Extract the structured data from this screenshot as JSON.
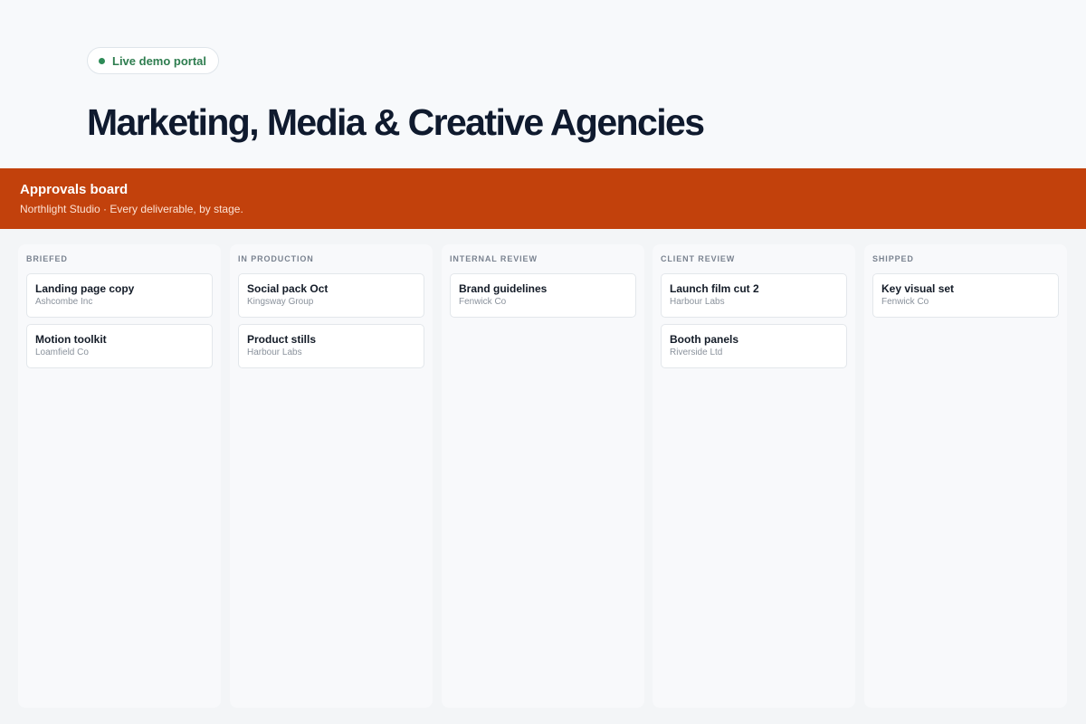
{
  "hero": {
    "badge_label": "Live demo portal",
    "title": "Marketing, Media & Creative Agencies"
  },
  "banner": {
    "title": "Approvals board",
    "subtitle": "Northlight Studio · Every deliverable, by stage."
  },
  "columns": [
    {
      "heading": "Briefed",
      "cards": [
        {
          "title": "Landing page copy",
          "client": "Ashcombe Inc"
        },
        {
          "title": "Motion toolkit",
          "client": "Loamfield Co"
        }
      ]
    },
    {
      "heading": "In Production",
      "cards": [
        {
          "title": "Social pack Oct",
          "client": "Kingsway Group"
        },
        {
          "title": "Product stills",
          "client": "Harbour Labs"
        }
      ]
    },
    {
      "heading": "Internal Review",
      "cards": [
        {
          "title": "Brand guidelines",
          "client": "Fenwick Co"
        }
      ]
    },
    {
      "heading": "Client Review",
      "cards": [
        {
          "title": "Launch film cut 2",
          "client": "Harbour Labs"
        },
        {
          "title": "Booth panels",
          "client": "Riverside Ltd"
        }
      ]
    },
    {
      "heading": "Shipped",
      "cards": [
        {
          "title": "Key visual set",
          "client": "Fenwick Co"
        }
      ]
    }
  ],
  "colors": {
    "banner": "#c2410c",
    "badge_dot": "#2e8b57",
    "badge_text": "#2e7d4f"
  }
}
